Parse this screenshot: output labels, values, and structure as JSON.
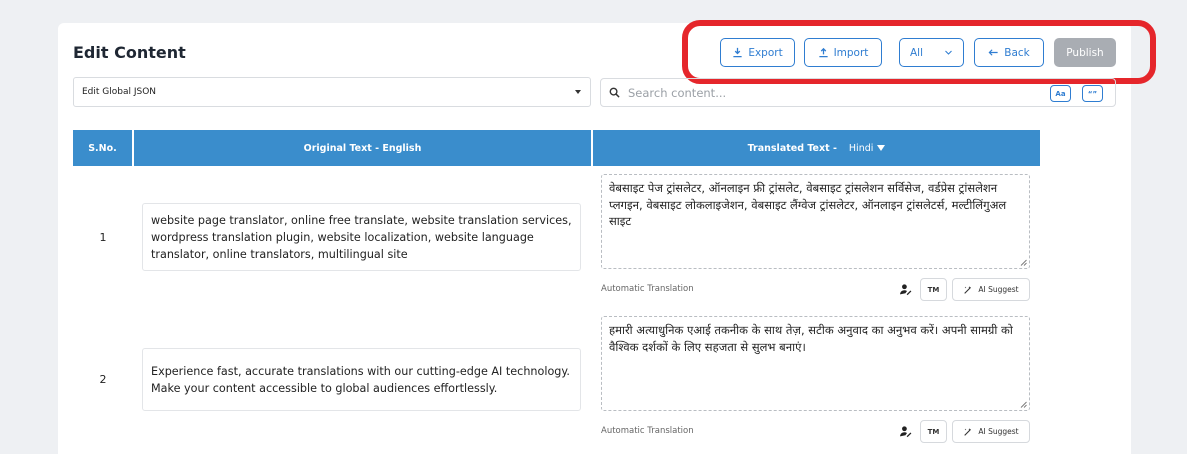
{
  "page": {
    "title": "Edit Content"
  },
  "toolbar": {
    "export_label": "Export",
    "import_label": "Import",
    "filter_value": "All",
    "back_label": "Back",
    "publish_label": "Publish"
  },
  "json_select": {
    "value": "Edit Global JSON"
  },
  "search": {
    "placeholder": "Search content..."
  },
  "search_options": {
    "case_label": "Aa",
    "quote_label": "“”"
  },
  "table": {
    "headers": {
      "sno": "S.No.",
      "original": "Original Text - English",
      "translated": "Translated Text -",
      "language": "Hindi"
    },
    "rows": [
      {
        "sno": "1",
        "original": "website page translator, online free translate, website translation services, wordpress translation plugin, website localization, website language translator, online translators, multilingual site",
        "translated": "वेबसाइट पेज ट्रांसलेटर, ऑनलाइन फ्री ट्रांसलेट, वेबसाइट ट्रांसलेशन सर्विसेज, वर्डप्रेस ट्रांसलेशन प्लगइन, वेबसाइट लोकलाइजेशन, वेबसाइट लैंग्वेज ट्रांसलेटर, ऑनलाइन ट्रांसलेटर्स, मल्टीलिंगुअल साइट",
        "method": "Automatic Translation",
        "tm_label": "TM",
        "ai_label": "AI Suggest"
      },
      {
        "sno": "2",
        "original": "Experience fast, accurate translations with our cutting-edge AI technology. Make your content accessible to global audiences effortlessly.",
        "translated": "हमारी अत्याधुनिक एआई तकनीक के साथ तेज़, सटीक अनुवाद का अनुभव करें। अपनी सामग्री को वैश्विक दर्शकों के लिए सहजता से सुलभ बनाएं।",
        "method": "Automatic Translation",
        "tm_label": "TM",
        "ai_label": "AI Suggest"
      }
    ]
  },
  "colors": {
    "accent": "#2f7dd1",
    "header_bg": "#3a8dcc",
    "highlight": "#e5262b",
    "publish_disabled": "#a9adb3"
  }
}
